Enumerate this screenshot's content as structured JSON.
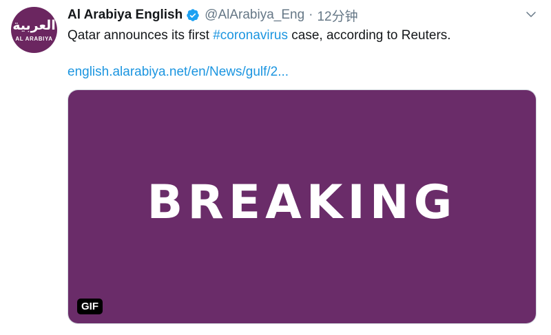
{
  "account": {
    "display_name": "Al Arabiya English",
    "handle": "@AlArabiya_Eng",
    "separator": "·",
    "time": "12分钟",
    "verified": true
  },
  "avatar": {
    "logo_main": "العربية",
    "logo_sub": "AL ARABIYA",
    "background": "#6b2660"
  },
  "tweet": {
    "text_before": "Qatar announces its first ",
    "hashtag": "#coronavirus",
    "text_after": " case, according to Reuters.",
    "link": "english.alarabiya.net/en/News/gulf/2..."
  },
  "media": {
    "headline": "BREAKING",
    "badge": "GIF",
    "background": "#6a2c69"
  },
  "colors": {
    "link": "#1b95e0",
    "muted": "#657786",
    "verified": "#1da1f2"
  },
  "icons": {
    "verified": "verified-badge-icon",
    "menu": "chevron-down-icon"
  }
}
